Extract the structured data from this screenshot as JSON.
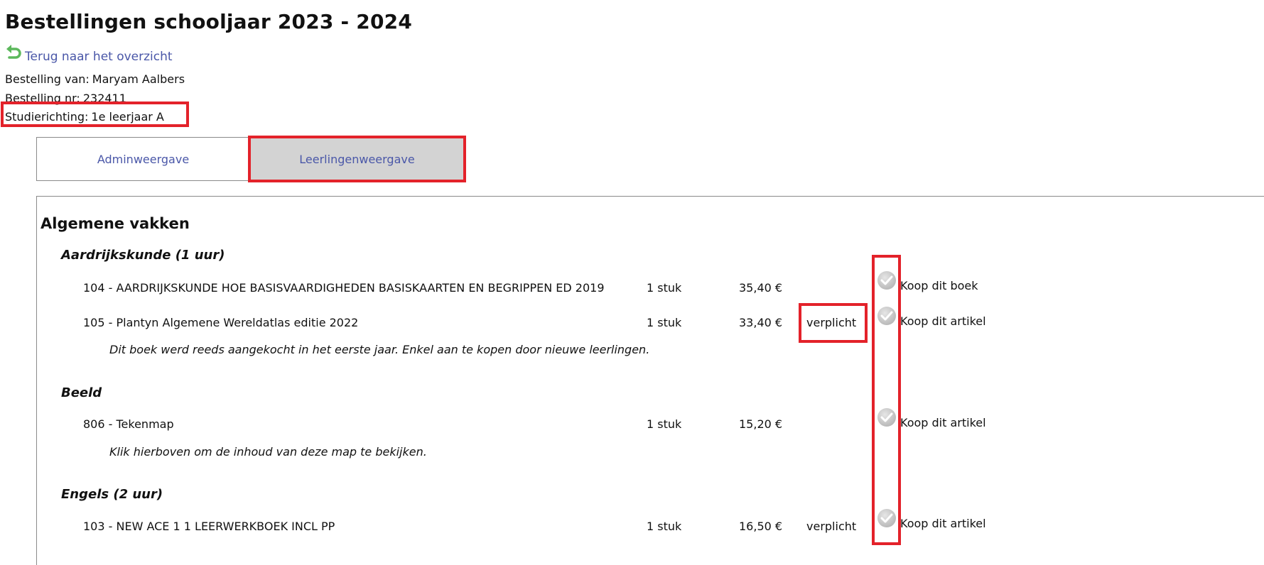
{
  "page": {
    "title": "Bestellingen schooljaar 2023 - 2024",
    "back_link": "Terug naar het overzicht"
  },
  "order": {
    "from_label": "Bestelling van:",
    "from_value": "Maryam Aalbers",
    "nr_label": "Bestelling nr:",
    "nr_value": "232411",
    "study_label": "Studierichting:",
    "study_value": "1e leerjaar A"
  },
  "tabs": [
    {
      "label": "Adminweergave",
      "active": false
    },
    {
      "label": "Leerlingenweergave",
      "active": true
    }
  ],
  "section": {
    "title": "Algemene vakken"
  },
  "subjects": [
    {
      "name": "Aardrijkskunde (1 uur)",
      "items": [
        {
          "desc": "104 - AARDRIJKSKUNDE HOE BASISVAARDIGHEDEN BASISKAARTEN EN BEGRIPPEN ED 2019",
          "qty": "1 stuk",
          "price": "35,40 €",
          "required": "",
          "action": "Koop dit boek",
          "note": ""
        },
        {
          "desc": "105 - Plantyn Algemene Wereldatlas editie 2022",
          "qty": "1 stuk",
          "price": "33,40 €",
          "required": "verplicht",
          "action": "Koop dit artikel",
          "note": "Dit boek werd reeds aangekocht in het eerste jaar. Enkel aan te kopen door nieuwe leerlingen."
        }
      ]
    },
    {
      "name": "Beeld",
      "items": [
        {
          "desc": "806 - Tekenmap",
          "qty": "1 stuk",
          "price": "15,20 €",
          "required": "",
          "action": "Koop dit artikel",
          "note": "Klik hierboven om de inhoud van deze map te bekijken."
        }
      ]
    },
    {
      "name": "Engels (2 uur)",
      "items": [
        {
          "desc": "103 - NEW ACE 1 1 LEERWERKBOEK INCL PP",
          "qty": "1 stuk",
          "price": "16,50 €",
          "required": "verplicht",
          "action": "Koop dit artikel",
          "note": ""
        }
      ]
    }
  ],
  "colors": {
    "highlight": "#e3222a",
    "link": "#4a57a8",
    "active_tab_bg": "#d3d3d3",
    "back_arrow": "#5cb85c"
  }
}
